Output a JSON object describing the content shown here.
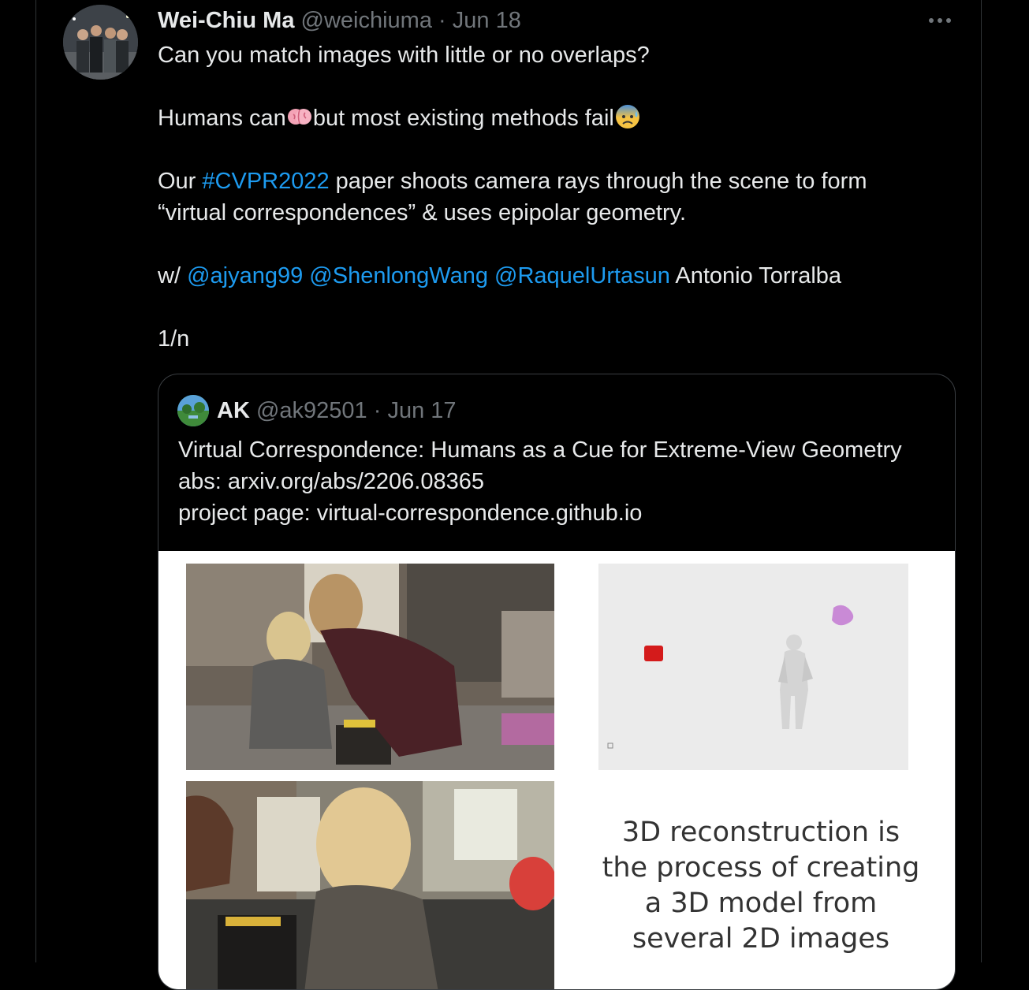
{
  "tweet": {
    "author_name": "Wei-Chiu Ma",
    "handle": "@weichiuma",
    "separator": "·",
    "date": "Jun 18",
    "more_icon": "more-horizontal-icon",
    "line1": "Can you match images with little or no overlaps?",
    "line2_a": "Humans can",
    "line2_b": "but most existing methods fail",
    "line3_a": "Our ",
    "hashtag": "#CVPR2022",
    "line3_b": " paper shoots camera rays through the scene to form",
    "line4": "“virtual correspondences” & uses epipolar geometry.",
    "line5_w": "w/ ",
    "mention1": "@ajyang99",
    "mention2": "@ShenlongWang",
    "mention3": "@RaquelUrtasun",
    "line5_tail": " Antonio Torralba",
    "line6": "1/n"
  },
  "quote": {
    "author_name": "AK",
    "handle": "@ak92501",
    "separator": "·",
    "date": "Jun 17",
    "line1": "Virtual Correspondence: Humans as a Cue for Extreme-View Geometry",
    "line2": "abs: arxiv.org/abs/2206.08365",
    "line3": "project page: virtual-correspondence.github.io",
    "media_caption": [
      "3D reconstruction is",
      "the process of creating",
      "a 3D model from",
      "several 2D images"
    ]
  },
  "colors": {
    "background": "#000000",
    "text": "#e7e9ea",
    "muted": "#71767b",
    "link": "#1d9bf0",
    "border": "#2f3336"
  }
}
